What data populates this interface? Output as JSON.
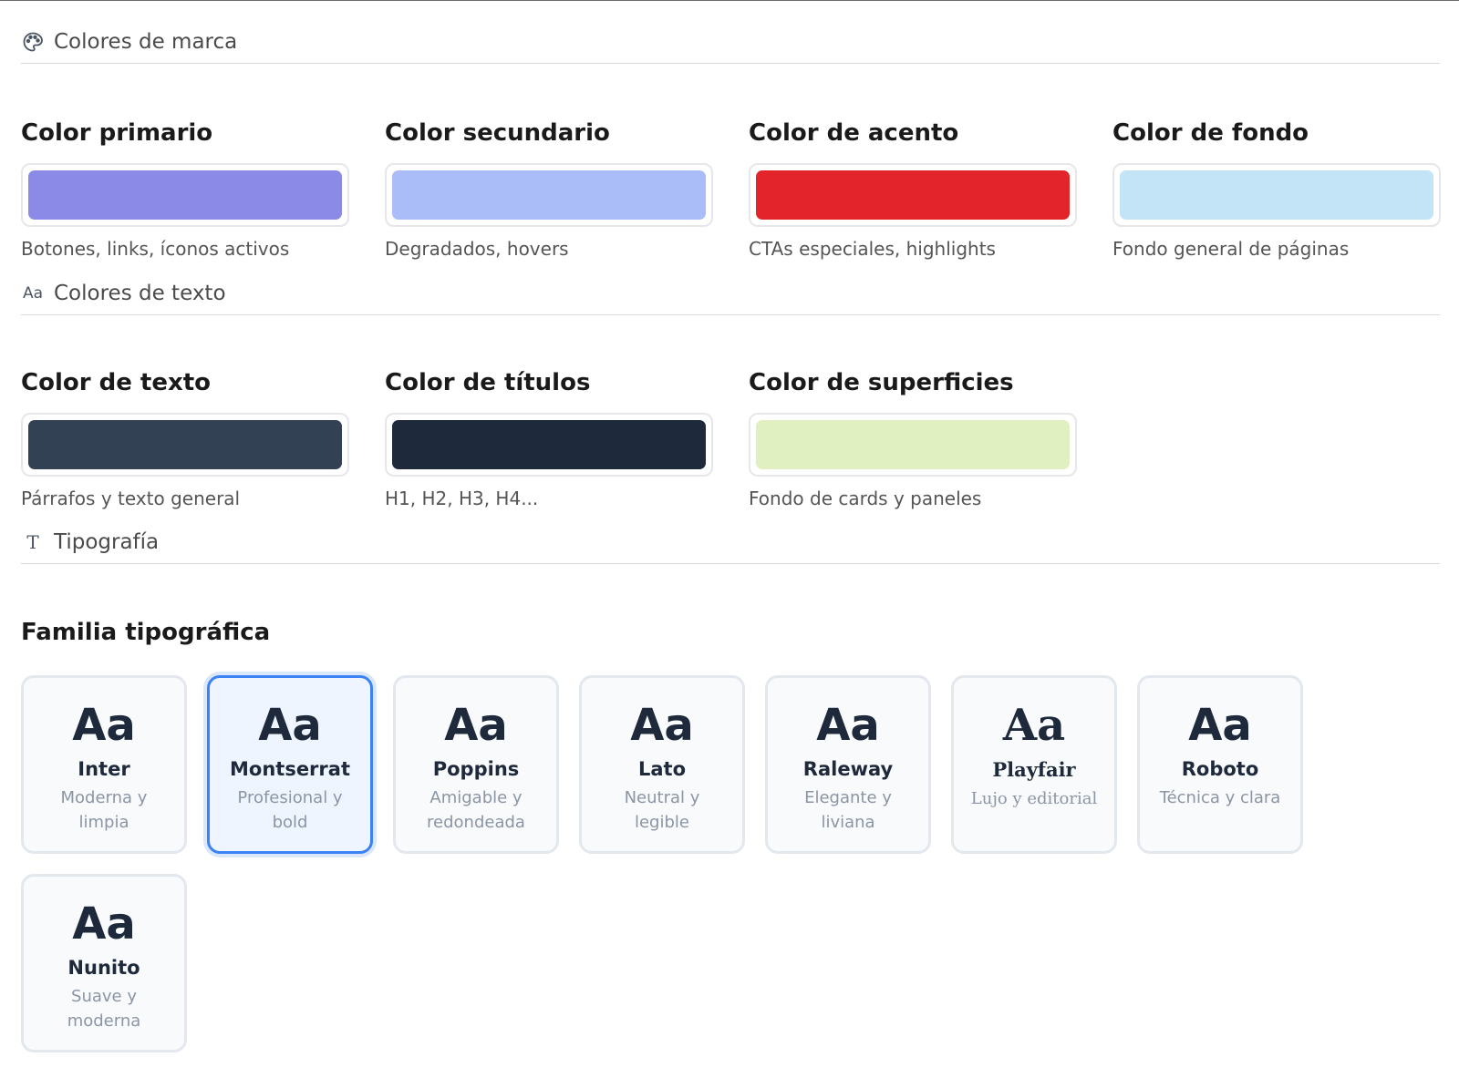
{
  "sections": {
    "brand": {
      "title": "Colores de marca",
      "icon": "palette-icon"
    },
    "text": {
      "title": "Colores de texto",
      "icon": "text-size-icon",
      "icon_glyph": "Aa"
    },
    "typography": {
      "title": "Tipografía",
      "icon": "type-icon",
      "icon_glyph": "T"
    }
  },
  "brand_colors": [
    {
      "label": "Color primario",
      "color": "#8b8ae6",
      "desc": "Botones, links, íconos activos"
    },
    {
      "label": "Color secundario",
      "color": "#abbdf9",
      "desc": "Degradados, hovers"
    },
    {
      "label": "Color de acento",
      "color": "#e3242b",
      "desc": "CTAs especiales, highlights"
    },
    {
      "label": "Color de fondo",
      "color": "#c3e4f7",
      "desc": "Fondo general de páginas"
    }
  ],
  "text_colors": [
    {
      "label": "Color de texto",
      "color": "#334155",
      "desc": "Párrafos y texto general"
    },
    {
      "label": "Color de títulos",
      "color": "#1e293b",
      "desc": "H1, H2, H3, H4..."
    },
    {
      "label": "Color de superficies",
      "color": "#e0f0c0",
      "desc": "Fondo de cards y paneles"
    }
  ],
  "typography": {
    "family_title": "Familia tipográfica",
    "sample": "Aa",
    "fonts": [
      {
        "name": "Inter",
        "desc": "Moderna y limpia",
        "selected": false
      },
      {
        "name": "Montserrat",
        "desc": "Profesional y bold",
        "selected": true
      },
      {
        "name": "Poppins",
        "desc": "Amigable y redondeada",
        "selected": false
      },
      {
        "name": "Lato",
        "desc": "Neutral y legible",
        "selected": false
      },
      {
        "name": "Raleway",
        "desc": "Elegante y liviana",
        "selected": false
      },
      {
        "name": "Playfair",
        "desc": "Lujo y editorial",
        "selected": false
      },
      {
        "name": "Roboto",
        "desc": "Técnica y clara",
        "selected": false
      },
      {
        "name": "Nunito",
        "desc": "Suave y moderna",
        "selected": false
      }
    ]
  }
}
